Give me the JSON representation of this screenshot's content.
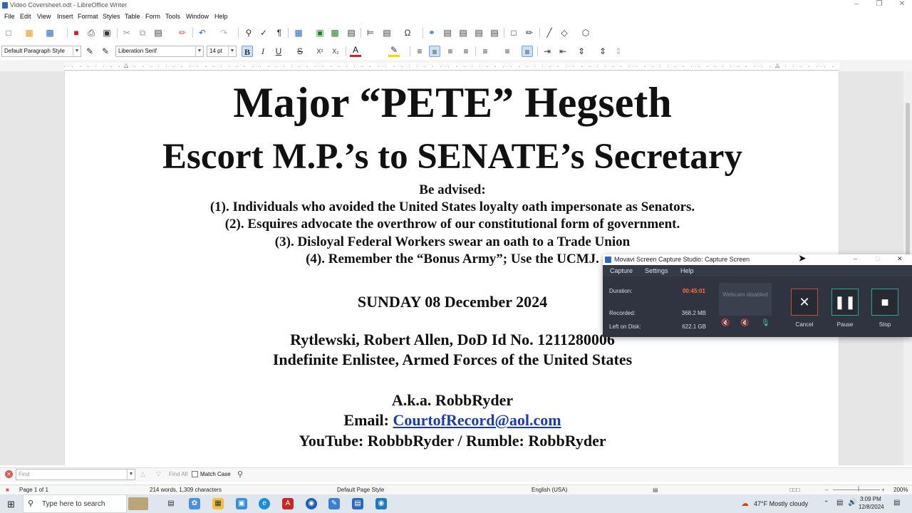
{
  "window": {
    "title": "Video Coversheet.odt - LibreOffice Writer"
  },
  "menu": [
    "File",
    "Edit",
    "View",
    "Insert",
    "Format",
    "Styles",
    "Table",
    "Form",
    "Tools",
    "Window",
    "Help"
  ],
  "toolbar": {
    "paragraph_style": "Default Paragraph Style",
    "font_name": "Liberation Serif",
    "font_size": "14 pt"
  },
  "document": {
    "lines": [
      "Major “PETE” Hegseth",
      "Escort M.P.’s to SENATE’s Secretary",
      "Be advised:",
      "(1). Individuals who avoided the United States loyalty oath impersonate as Senators.",
      "(2). Esquires advocate the overthrow of our constitutional form of government.",
      "(3). Disloyal Federal Workers swear an oath to a Trade Union",
      "(4). Remember the “Bonus Army”; Use the UCMJ.",
      "SUNDAY 08 December 2024",
      "Rytlewski, Robert Allen, DoD Id No. 1211280006",
      "Indefinite Enlistee, Armed Forces of the United States",
      "A.k.a. RobbRyder",
      "Email: ",
      "CourtofRecord@aol.com",
      "YouTube: RobbbRyder / Rumble: RobbRyder"
    ]
  },
  "findbar": {
    "placeholder": "Find",
    "find_all": "Find All",
    "match_case": "Match Case"
  },
  "statusbar": {
    "page": "Page 1 of 1",
    "words": "214 words, 1,309 characters",
    "page_style": "Default Page Style",
    "language": "English (USA)",
    "zoom": "200%"
  },
  "movavi": {
    "title": "Movavi Screen Capture Studio: Capture Screen",
    "menu": [
      "Capture",
      "Settings",
      "Help"
    ],
    "duration_label": "Duration:",
    "duration": "00:45:01",
    "recorded_label": "Recorded:",
    "recorded": "368.2 MB",
    "disk_label": "Left on Disk:",
    "disk": "622.1 GB",
    "webcam": "Webcam disabled",
    "cancel": "Cancel",
    "pause": "Pause",
    "stop": "Stop",
    "accent": "#ff7043"
  },
  "taskbar": {
    "search_placeholder": "Type here to search",
    "weather": "47°F  Mostly cloudy",
    "time": "3:09 PM",
    "date": "12/8/2024"
  }
}
